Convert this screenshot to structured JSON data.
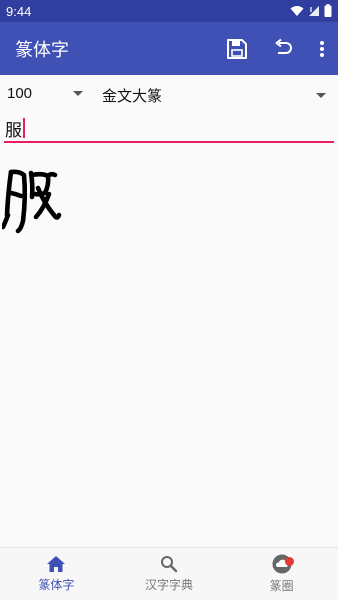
{
  "status_bar": {
    "time": "9:44",
    "icons": [
      "wifi-icon",
      "signal-icon",
      "battery-icon"
    ]
  },
  "app_bar": {
    "title": "篆体字",
    "actions": [
      "save-icon",
      "undo-icon",
      "more-vert-icon"
    ]
  },
  "controls": {
    "size_value": "100",
    "font_style": "金文大篆",
    "input_text": "服"
  },
  "preview": {
    "glyph": "服"
  },
  "bottom_nav": {
    "items": [
      {
        "label": "篆体字",
        "icon": "home-icon",
        "active": true
      },
      {
        "label": "汉字字典",
        "icon": "search-icon",
        "active": false
      },
      {
        "label": "篆圈",
        "icon": "cloud-icon",
        "active": false,
        "badge": true
      }
    ]
  },
  "colors": {
    "primary": "#3f51b5",
    "primary_dark": "#303f9f",
    "accent": "#e91e63",
    "badge": "#e53935"
  }
}
